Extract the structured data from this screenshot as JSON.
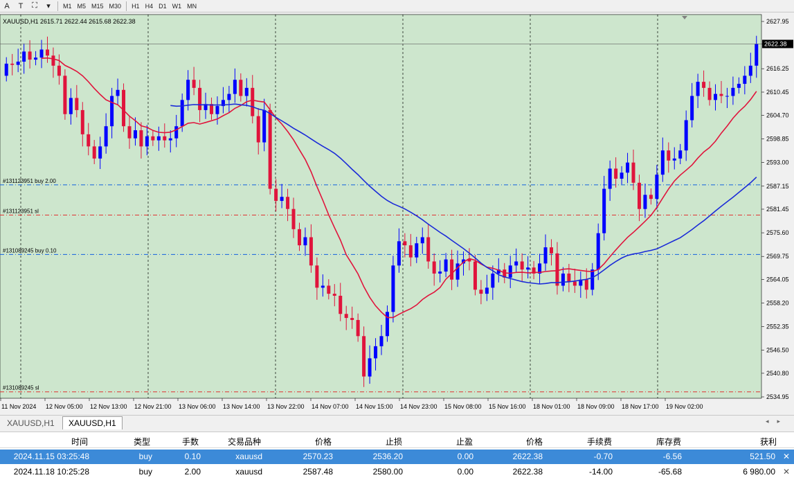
{
  "toolbar": {
    "items": [
      {
        "name": "font-icon",
        "label": "A"
      },
      {
        "name": "text-label-icon",
        "label": "T"
      },
      {
        "name": "shapes-icon",
        "label": "⛶"
      },
      {
        "name": "dropdown-icon",
        "label": "▾"
      }
    ],
    "timeframes": [
      "M1",
      "M5",
      "M15",
      "M30",
      "H1",
      "H4",
      "D1",
      "W1",
      "MN"
    ]
  },
  "chart": {
    "header": "XAUUSD,H1  2615.71 2622.44 2615.68 2622.38",
    "bg_color": "#cde6cd",
    "bull_color": "#0000ff",
    "bear_color": "#e0143c",
    "current_price_label": "2622.38"
  },
  "chart_data": {
    "type": "candlestick",
    "symbol": "XAUUSD",
    "timeframe": "H1",
    "ylim": [
      2534.95,
      2627.95
    ],
    "price_ticks": [
      "2627.95",
      "2622.38",
      "2616.25",
      "2610.45",
      "2604.70",
      "2598.85",
      "2593.00",
      "2587.15",
      "2581.45",
      "2575.60",
      "2569.75",
      "2564.05",
      "2558.20",
      "2552.35",
      "2546.50",
      "2540.80",
      "2534.95"
    ],
    "time_labels": [
      "11 Nov 2024",
      "12 Nov 05:00",
      "12 Nov 13:00",
      "12 Nov 21:00",
      "13 Nov 06:00",
      "13 Nov 14:00",
      "13 Nov 22:00",
      "14 Nov 07:00",
      "14 Nov 15:00",
      "14 Nov 23:00",
      "15 Nov 08:00",
      "15 Nov 16:00",
      "18 Nov 01:00",
      "18 Nov 09:00",
      "18 Nov 17:00",
      "19 Nov 02:00"
    ],
    "closes": [
      2617.5,
      2617.2,
      2618.0,
      2620.5,
      2618.5,
      2619.0,
      2621.0,
      2619.5,
      2617.0,
      2614.5,
      2605.0,
      2609.0,
      2606.0,
      2600.0,
      2597.0,
      2594.0,
      2597.0,
      2602.0,
      2609.5,
      2611.0,
      2602.0,
      2599.0,
      2601.0,
      2597.0,
      2599.5,
      2598.5,
      2599.5,
      2598.5,
      2599.0,
      2602.0,
      2608.5,
      2613.5,
      2611.5,
      2606.0,
      2607.5,
      2605.0,
      2607.0,
      2608.5,
      2610.0,
      2613.5,
      2609.5,
      2611.5,
      2604.5,
      2598.0,
      2606.0,
      2586.5,
      2583.5,
      2584.5,
      2581.5,
      2576.5,
      2572.5,
      2574.5,
      2567.5,
      2562.0,
      2562.5,
      2560.5,
      2560.0,
      2555.5,
      2554.5,
      2554.0,
      2550.0,
      2540.0,
      2544.5,
      2547.5,
      2550.0,
      2556.0,
      2567.5,
      2573.5,
      2572.5,
      2569.5,
      2573.0,
      2574.5,
      2568.5,
      2565.5,
      2566.0,
      2569.0,
      2564.0,
      2568.0,
      2569.0,
      2568.5,
      2561.5,
      2560.5,
      2562.0,
      2565.5,
      2566.5,
      2564.5,
      2567.5,
      2568.5,
      2566.5,
      2567.0,
      2565.5,
      2568.0,
      2572.0,
      2570.5,
      2562.5,
      2565.5,
      2563.5,
      2562.5,
      2564.0,
      2561.5,
      2566.5,
      2575.5,
      2586.5,
      2591.5,
      2589.0,
      2590.5,
      2593.0,
      2588.0,
      2581.5,
      2585.0,
      2584.0,
      2590.0,
      2596.0,
      2593.5,
      2594.0,
      2596.0,
      2603.5,
      2609.5,
      2613.0,
      2611.5,
      2608.5,
      2610.0,
      2609.5,
      2609.5,
      2611.5,
      2612.5,
      2614.5,
      2617.0,
      2622.4
    ],
    "ma_red": {
      "name": "",
      "period_hint": "fast MA",
      "color": "#e0143c"
    },
    "ma_blue": {
      "name": "",
      "period_hint": "slow MA",
      "color": "#1a2ad8"
    },
    "horizontal_lines": [
      {
        "label": "#131123951 buy 2.00",
        "price": 2587.48,
        "color": "#1060e0"
      },
      {
        "label": "#131123951 sl",
        "price": 2580.0,
        "color": "#e03030"
      },
      {
        "label": "#131089245 buy 0.10",
        "price": 2570.23,
        "color": "#1060e0"
      },
      {
        "label": "#131089245 sl",
        "price": 2536.2,
        "color": "#e03030"
      }
    ]
  },
  "tabs": [
    "XAUUSD,H1",
    "XAUUSD,H1"
  ],
  "trades": {
    "headers": [
      "时间",
      "类型",
      "手数",
      "交易品种",
      "价格",
      "止损",
      "止盈",
      "价格",
      "手续费",
      "库存费",
      "获利"
    ],
    "rows": [
      [
        "2024.11.15 03:25:48",
        "buy",
        "0.10",
        "xauusd",
        "2570.23",
        "2536.20",
        "0.00",
        "2622.38",
        "-0.70",
        "-6.56",
        "521.50"
      ],
      [
        "2024.11.18 10:25:28",
        "buy",
        "2.00",
        "xauusd",
        "2587.48",
        "2580.00",
        "0.00",
        "2622.38",
        "-14.00",
        "-65.68",
        "6 980.00"
      ]
    ]
  }
}
